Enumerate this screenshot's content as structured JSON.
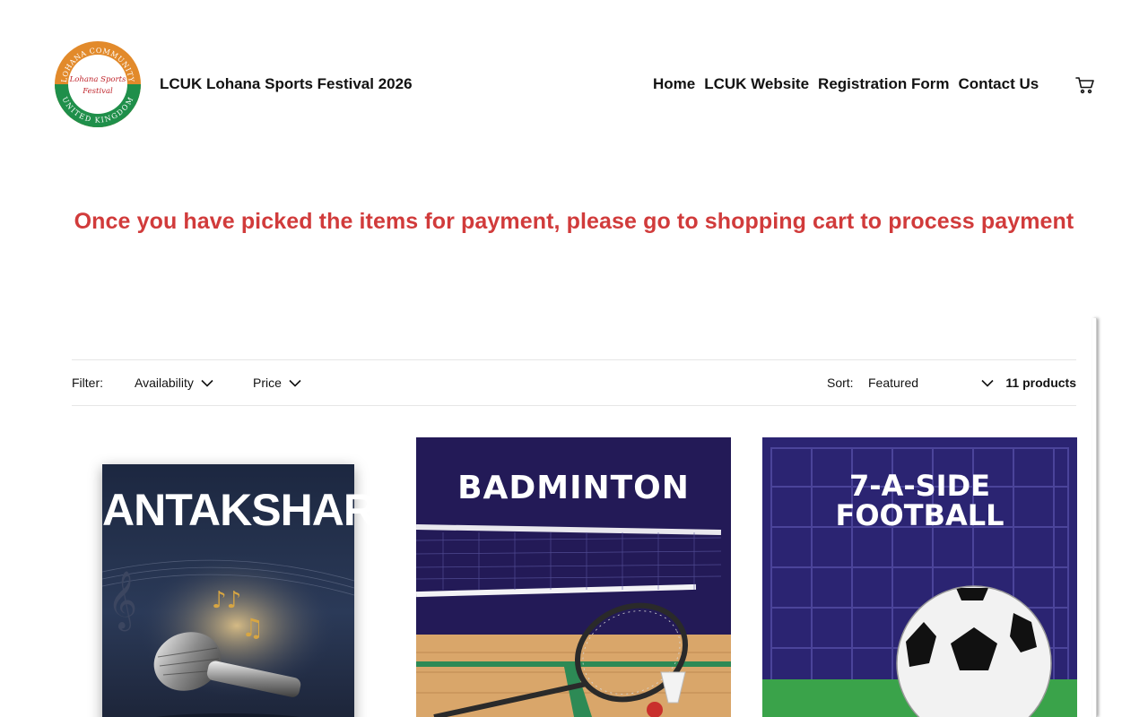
{
  "header": {
    "logo": {
      "ring_text": "LOHANA COMMUNITY UNITED KINGDOM",
      "center_line1": "Lohana Sports",
      "center_line2": "Festival"
    },
    "site_title": "LCUK Lohana Sports Festival 2026",
    "nav": [
      {
        "label": "Home"
      },
      {
        "label": "LCUK Website"
      },
      {
        "label": "Registration Form"
      },
      {
        "label": "Contact Us"
      }
    ],
    "cart_icon": "cart-icon"
  },
  "notice": "Once you have picked the items for payment, please go to shopping cart to process payment",
  "filters": {
    "filter_label": "Filter:",
    "availability_label": "Availability",
    "price_label": "Price",
    "sort_label": "Sort:",
    "sort_value": "Featured",
    "product_count": "11 products"
  },
  "products": [
    {
      "title": "ANTAKSHARI"
    },
    {
      "title": "BADMINTON"
    },
    {
      "title_line1": "7-A-SIDE",
      "title_line2": "FOOTBALL"
    }
  ],
  "colors": {
    "notice": "#d13b3b",
    "tile_navy": "#201a52",
    "tile_purple": "#2a2470"
  }
}
